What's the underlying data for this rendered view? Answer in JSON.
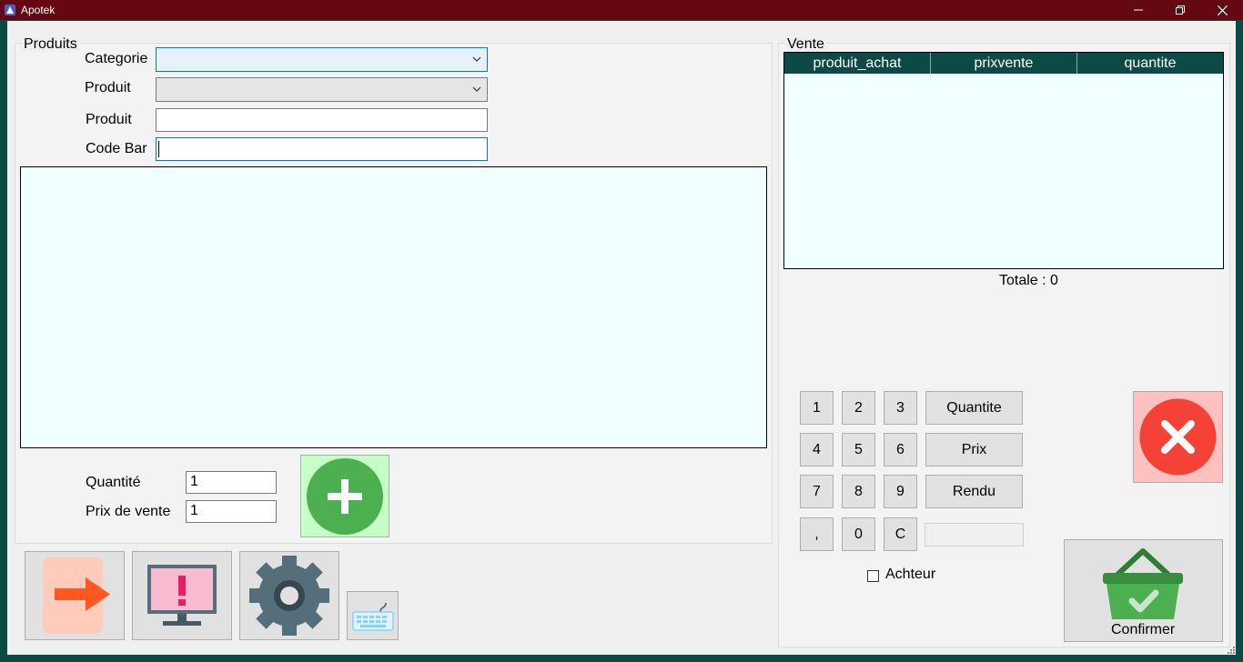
{
  "window": {
    "title": "Apotek"
  },
  "produits": {
    "legend": "Produits",
    "categorie_label": "Categorie",
    "categorie_value": "",
    "produit_combo_label": "Produit",
    "produit_combo_value": "",
    "produit_text_label": "Produit",
    "produit_text_value": "",
    "codebar_label": "Code Bar",
    "codebar_value": "",
    "quantite_label": "Quantité",
    "quantite_value": "1",
    "prix_label": "Prix de vente",
    "prix_value": "1"
  },
  "vente": {
    "legend": "Vente",
    "columns": [
      "produit_achat",
      "prixvente",
      "quantite"
    ],
    "total_text": "Totale : 0"
  },
  "keypad": {
    "keys": [
      "1",
      "2",
      "3",
      "4",
      "5",
      "6",
      "7",
      "8",
      "9",
      ",",
      "0",
      "C"
    ],
    "quantite_label": "Quantite",
    "prix_label": "Prix",
    "rendu_label": "Rendu",
    "display_value": ""
  },
  "achteur_label": "Achteur",
  "confirmer_label": "Confirmer",
  "colors": {
    "titlebar": "#650811",
    "frame": "#0d4a46",
    "list_bg": "#f0ffff",
    "add_bg": "#c6ffc6",
    "add_circle": "#4caf50",
    "cancel_bg": "#ffc0c0",
    "cancel_circle": "#f44336"
  }
}
